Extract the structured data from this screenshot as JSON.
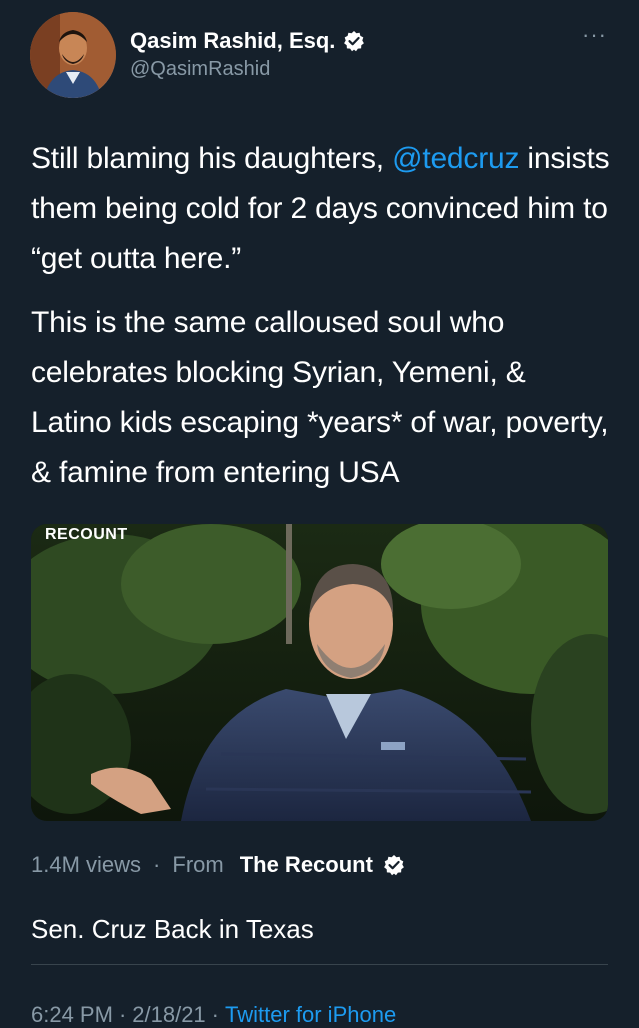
{
  "author": {
    "display_name": "Qasim Rashid, Esq.",
    "handle": "@QasimRashid",
    "verified": true
  },
  "more_label": "···",
  "tweet": {
    "paragraph1": {
      "before": "Still blaming his daughters, ",
      "mention": "@tedcruz",
      "after": " insists them being cold for 2 days convinced him to “get outta here.”"
    },
    "paragraph2": "This is the same calloused soul who celebrates blocking Syrian, Yemeni, & Latino kids escaping *years* of war, poverty, & famine from entering USA"
  },
  "media": {
    "watermark": "RECOUNT"
  },
  "stats": {
    "views": "1.4M views",
    "separator": "·",
    "from_label": "From",
    "source_name": "The Recount",
    "source_verified": true
  },
  "card_title": "Sen. Cruz Back in Texas",
  "timestamp": {
    "time": "6:24 PM",
    "date": "2/18/21",
    "separator": "·",
    "client": "Twitter for iPhone"
  },
  "colors": {
    "background": "#15202b",
    "link": "#1d9bf0",
    "secondary_text": "#8899a6",
    "verified_badge": "#ffffff"
  }
}
